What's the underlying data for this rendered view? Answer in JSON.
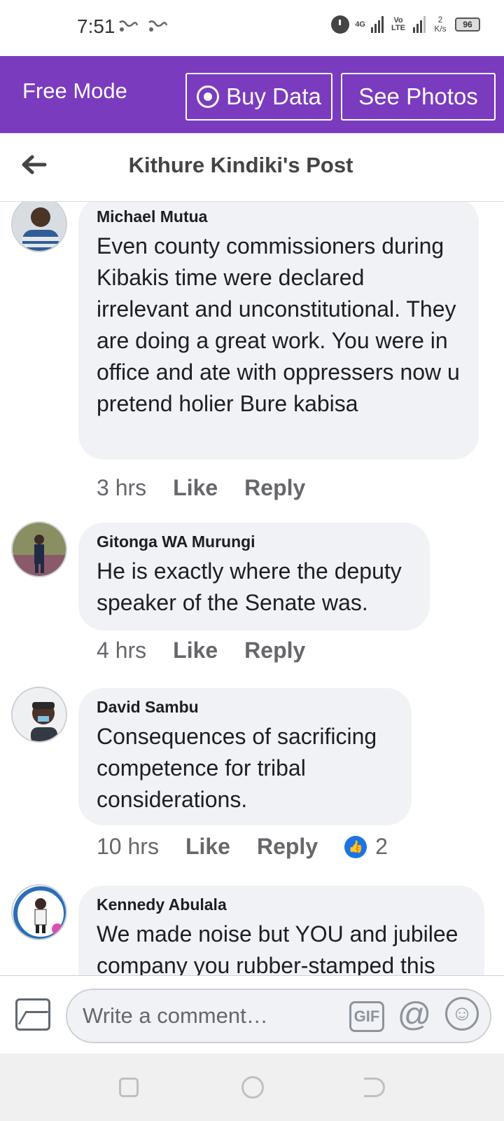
{
  "status_bar": {
    "time": "7:51",
    "network_label": "4G",
    "volte_label": "Vo LTE",
    "speed": "2 K/s",
    "battery": "96"
  },
  "top_bar": {
    "mode_label": "Free Mode",
    "buy_data_label": "Buy Data",
    "see_photos_label": "See Photos"
  },
  "header": {
    "title": "Kithure Kindiki's Post"
  },
  "comments": [
    {
      "author": "Michael Mutua",
      "text": "Even county commissioners during Kibakis time were declared irrelevant and unconstitutional. They are doing a great work. You were in office and ate with oppressers now u pretend holier Bure kabisa",
      "time": "3 hrs",
      "like_label": "Like",
      "reply_label": "Reply"
    },
    {
      "author": "Gitonga WA Murungi",
      "text": "He is exactly where the deputy speaker of the Senate was.",
      "time": "4 hrs",
      "like_label": "Like",
      "reply_label": "Reply"
    },
    {
      "author": "David Sambu",
      "text": "Consequences of sacrificing competence for tribal considerations.",
      "time": "10 hrs",
      "like_label": "Like",
      "reply_label": "Reply",
      "reactions": "2"
    },
    {
      "author": "Kennedy Abulala",
      "text": "We made noise but YOU and jubilee company you rubber-stamped this"
    }
  ],
  "composer": {
    "placeholder": "Write a comment…",
    "gif_label": "GIF",
    "mention_label": "@"
  },
  "colors": {
    "brand_purple": "#7b3bbf",
    "bubble": "#f0f2f5",
    "like_blue": "#1b74e4"
  }
}
